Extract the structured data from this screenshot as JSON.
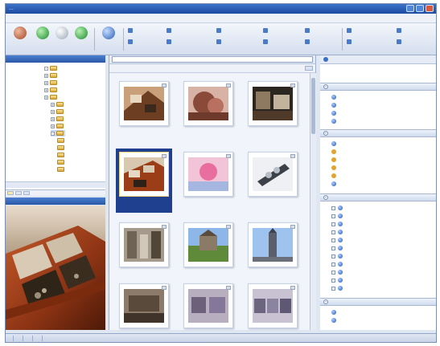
{
  "window": {
    "title": "..."
  },
  "menu": [],
  "toolbar": {
    "buttons": [],
    "small_actions": []
  },
  "folder_panel": {
    "header": "",
    "items": [],
    "tabs": []
  },
  "preview_panel": {
    "header": ""
  },
  "browser": {
    "path": "",
    "subtoolbar": [],
    "view_mode": "",
    "thumbnails": [
      {
        "caption": ""
      },
      {
        "caption": ""
      },
      {
        "caption": ""
      },
      {
        "caption": ""
      },
      {
        "caption": ""
      },
      {
        "caption": ""
      },
      {
        "caption": ""
      },
      {
        "caption": ""
      },
      {
        "caption": ""
      },
      {
        "caption": ""
      },
      {
        "caption": ""
      },
      {
        "caption": ""
      }
    ],
    "selected_index": 3
  },
  "properties": {
    "header": "",
    "groups": [
      {
        "title": "",
        "items": []
      },
      {
        "title": "",
        "items": []
      },
      {
        "title": "",
        "items": []
      },
      {
        "title": "",
        "items": []
      }
    ]
  },
  "statusbar": [],
  "colors": {
    "accent": "#2a58a8",
    "selection": "#1f3f8f",
    "panel": "#dfe7f3"
  },
  "icons": [
    "window-minimize-icon",
    "window-maximize-icon",
    "window-close-icon",
    "folder-icon",
    "expand-icon"
  ]
}
